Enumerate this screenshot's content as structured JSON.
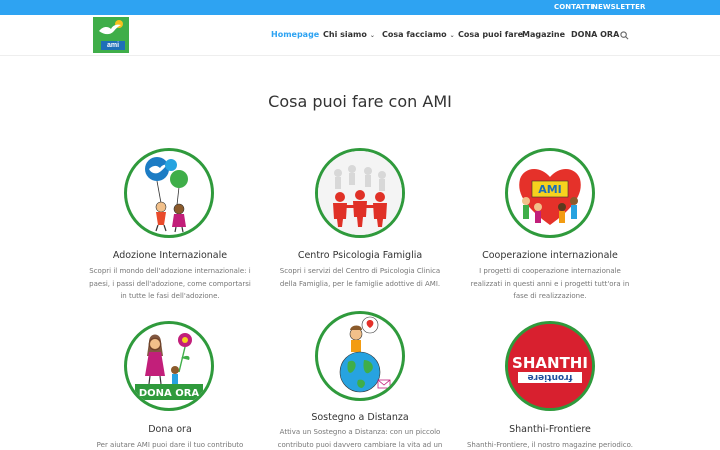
{
  "topbar": {
    "contatti": "CONTATTI",
    "newsletter": "NEWSLETTER"
  },
  "logo": {
    "text": "ami"
  },
  "nav": [
    {
      "label": "Homepage",
      "active": true,
      "dropdown": false
    },
    {
      "label": "Chi siamo",
      "active": false,
      "dropdown": true
    },
    {
      "label": "Cosa facciamo",
      "active": false,
      "dropdown": true
    },
    {
      "label": "Cosa puoi fare",
      "active": false,
      "dropdown": false
    },
    {
      "label": "Magazine",
      "active": false,
      "dropdown": false
    },
    {
      "label": "DONA ORA",
      "active": false,
      "dropdown": false
    }
  ],
  "colors": {
    "accent": "#2ea3f2",
    "circle_border": "#2f9a3c",
    "brand_green": "#3fae49"
  },
  "page": {
    "title": "Cosa puoi fare con AMI"
  },
  "cards": [
    {
      "title": "Adozione Internazionale",
      "text": "Scopri il mondo dell'adozione internazionale: i paesi, i passi dell'adozione, come comportarsi in tutte le fasi dell'adozione."
    },
    {
      "title": "Centro Psicologia Famiglia",
      "text": "Scopri i servizi del Centro di Psicologia Clinica della Famiglia, per le famiglie adottive di AMI."
    },
    {
      "title": "Cooperazione internazionale",
      "text": "I progetti di cooperazione internazionale realizzati in questi anni e i progetti tutt'ora in fase di realizzazione."
    },
    {
      "title": "Dona ora",
      "text": "Per aiutare AMI puoi dare il tuo contributo",
      "badge": "DONA ORA"
    },
    {
      "title": "Sostegno a Distanza",
      "text": "Attiva un Sostegno a Distanza: con un piccolo contributo puoi davvero cambiare la vita ad un"
    },
    {
      "title": "Shanthi-Frontiere",
      "text": "Shanthi-Frontiere, il nostro magazine periodico.",
      "badge": "SHANTHI",
      "badge_sub": "frontiere"
    }
  ],
  "cooperazione_sign": "AMI"
}
